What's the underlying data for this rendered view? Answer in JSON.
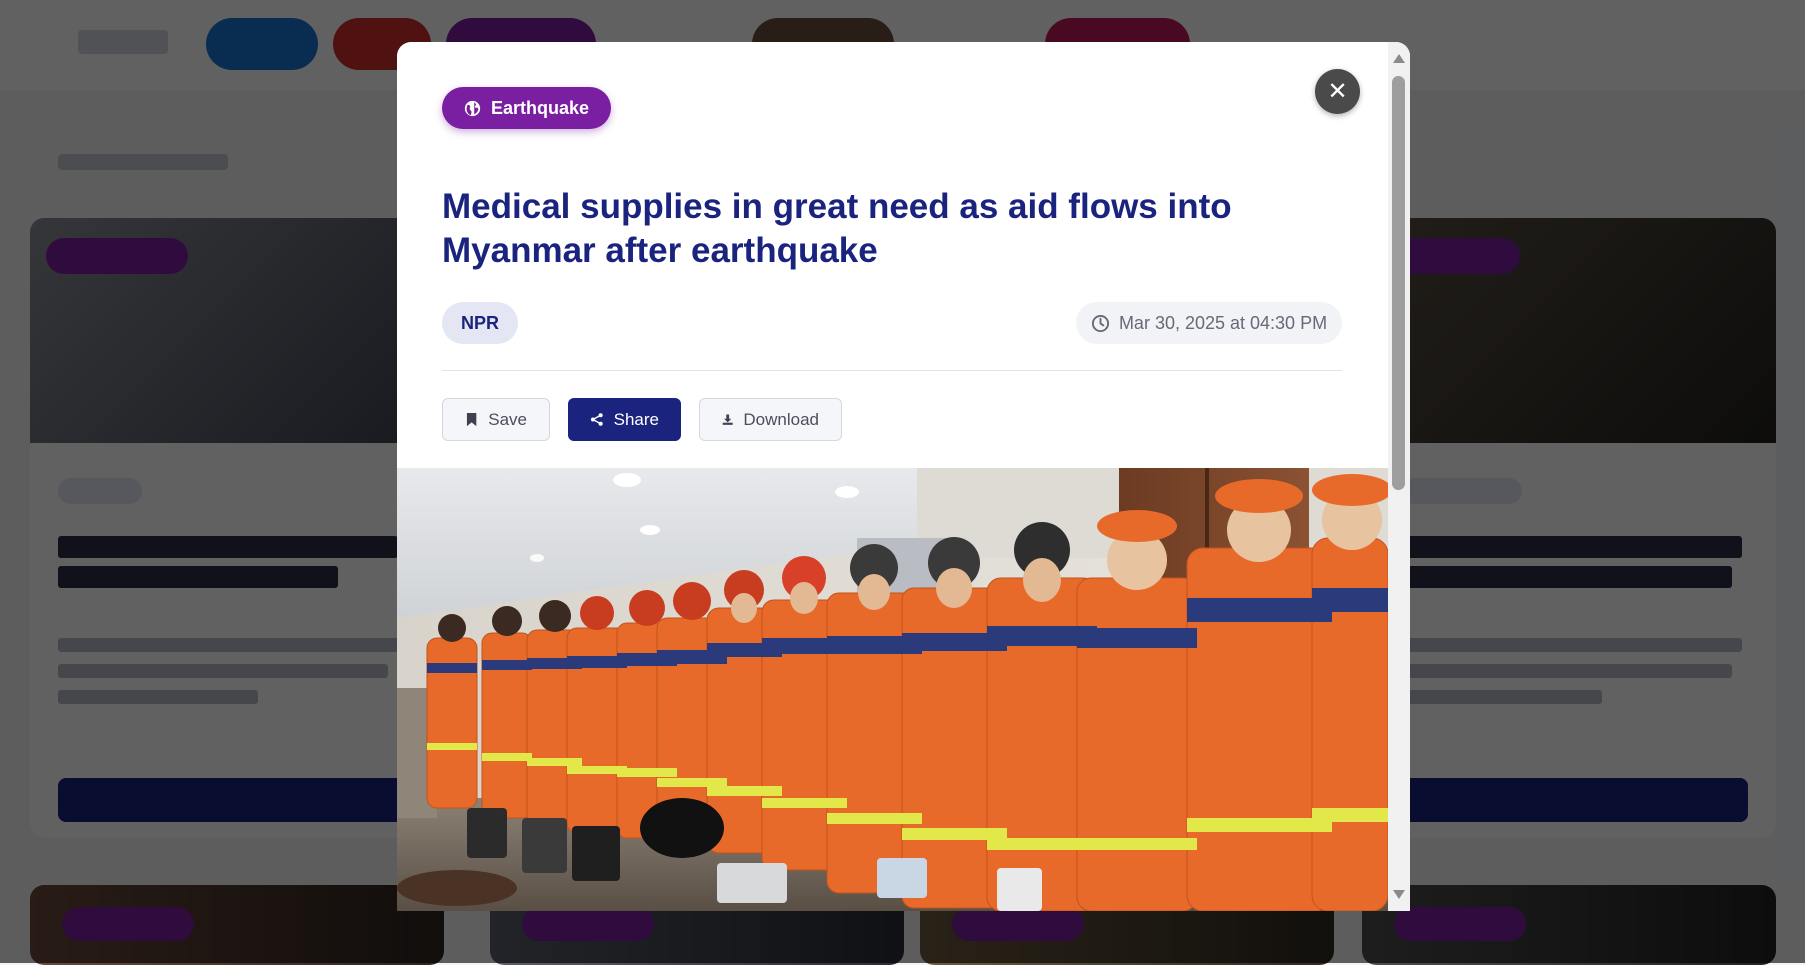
{
  "modal": {
    "category": "Earthquake",
    "category_icon": "globe-icon",
    "headline": "Medical supplies in great need as aid flows into Myanmar after earthquake",
    "source": "NPR",
    "date": "Mar 30, 2025 at 04:30 PM",
    "date_icon": "clock-icon",
    "actions": {
      "save": "Save",
      "share": "Share",
      "download": "Download"
    },
    "close_icon": "close-icon",
    "image_description_icon": "photo"
  },
  "colors": {
    "accent_navy": "#1a237e",
    "category_purple": "#7b1fa2",
    "overlay": "rgba(0,0,0,0.62)",
    "uniform_orange": "#e86a2a"
  }
}
